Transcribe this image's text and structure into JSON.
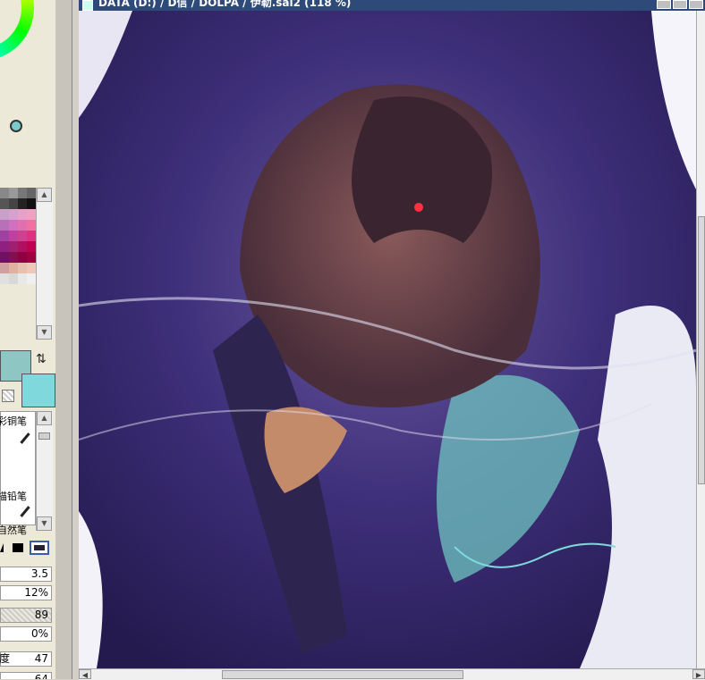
{
  "window": {
    "title": "DATA (D:) / D信 / DOLPA / 伊勒.sai2 (118 %)"
  },
  "colors": {
    "main_color": "#8ec6c4",
    "sub_color": "#7fd9dc",
    "title_bar": "#2e4a78",
    "panel_bg": "#ece9d8"
  },
  "swatches": [
    "#888888",
    "#999999",
    "#777777",
    "#666666",
    "#555555",
    "#444444",
    "#222222",
    "#111111",
    "#c8a0c8",
    "#d8a0d0",
    "#e8a0c8",
    "#f0a0c0",
    "#b870b8",
    "#d070c0",
    "#e070b0",
    "#f070a0",
    "#a040a0",
    "#c040a0",
    "#d04090",
    "#e03080",
    "#902080",
    "#a02070",
    "#b01060",
    "#c00050",
    "#701060",
    "#801050",
    "#900040",
    "#a00040",
    "#d0a0a0",
    "#e0b0a0",
    "#e8c0b0",
    "#f0c8b8",
    "#e0e0e0",
    "#d8d8d8",
    "#e8e8e8",
    "#f0f0f0"
  ],
  "tools": {
    "item_1": "彩铜笔",
    "item_2": "描铅笔",
    "item_3": "自然笔"
  },
  "params": {
    "brush_size": "3.5",
    "min_size": "12%",
    "density": "89",
    "blend": "0%",
    "dilution_label": "度",
    "dilution": "47",
    "persistence": "64"
  }
}
